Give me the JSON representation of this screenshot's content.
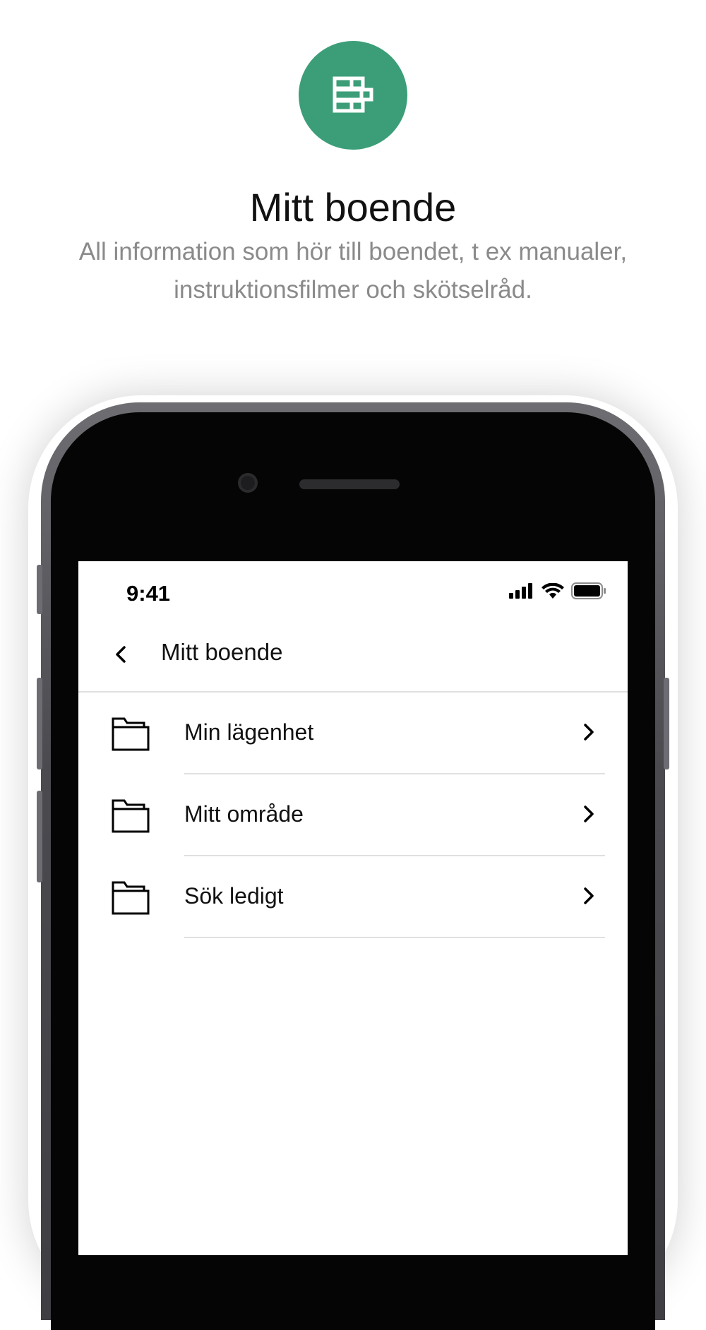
{
  "hero": {
    "icon": "building-blocks-icon",
    "accent_color": "#3b9e78",
    "title": "Mitt boende",
    "subtitle": "All information som hör till boendet, t ex manualer, instruktionsfilmer och skötselråd."
  },
  "status_bar": {
    "time": "9:41",
    "icons": [
      "signal-icon",
      "wifi-icon",
      "battery-icon"
    ]
  },
  "nav": {
    "back_icon": "chevron-left-icon",
    "title": "Mitt boende"
  },
  "list": {
    "items": [
      {
        "label": "Min lägenhet",
        "icon": "folder-icon",
        "trailing_icon": "chevron-right-icon"
      },
      {
        "label": "Mitt område",
        "icon": "folder-icon",
        "trailing_icon": "chevron-right-icon"
      },
      {
        "label": "Sök ledigt",
        "icon": "folder-icon",
        "trailing_icon": "chevron-right-icon"
      }
    ]
  }
}
